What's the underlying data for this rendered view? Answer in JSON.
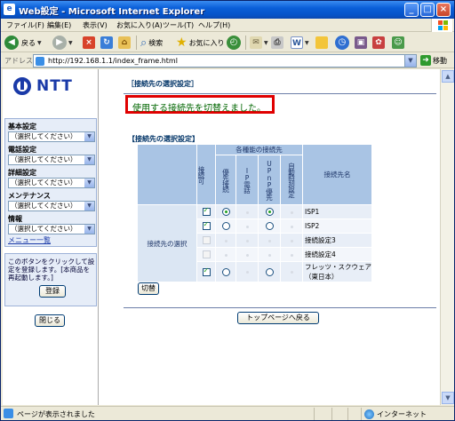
{
  "window": {
    "title": "Web設定 - Microsoft Internet Explorer",
    "min": "_",
    "max": "□",
    "close": "×"
  },
  "menu": [
    "ファイル(F)",
    "編集(E)",
    "表示(V)",
    "お気に入り(A)",
    "ツール(T)",
    "ヘルプ(H)"
  ],
  "toolbar": {
    "back": "戻る",
    "search": "検索",
    "favorites": "お気に入り"
  },
  "address": {
    "label": "アドレス(D)",
    "url": "http://192.168.1.1/index_frame.html",
    "go": "移動"
  },
  "left": {
    "logo": "NTT",
    "nav": [
      {
        "title": "基本設定",
        "value": "（選択してください）"
      },
      {
        "title": "電話設定",
        "value": "（選択してください）"
      },
      {
        "title": "詳細設定",
        "value": "（選択してください）"
      },
      {
        "title": "メンテナンス",
        "value": "（選択してください）"
      },
      {
        "title": "情報",
        "value": "（選択してください）"
      }
    ],
    "menu_list": "メニュー一覧",
    "hint": "このボタンをクリックして設定を登録します。[本商品を再起動します。]",
    "register": "登録",
    "close": "閉じる"
  },
  "main": {
    "header": "［接続先の選択設定］",
    "message": "使用する接続先を切替えました。",
    "section": "【接続先の選択設定】",
    "table": {
      "col_enable": "接続可",
      "col_group": "各種能の接続先",
      "col_priority": "優先接続",
      "col_ip_phone": "IP電話",
      "col_upnp": "UPnP優先",
      "col_auto": "自動時刻設定",
      "col_name": "接続先名",
      "row_label": "接続先の選択",
      "rows": [
        {
          "enabled": true,
          "name": "ISP1"
        },
        {
          "enabled": true,
          "name": "ISP2"
        },
        {
          "enabled": false,
          "name": "接続設定3"
        },
        {
          "enabled": false,
          "name": "接続設定4"
        },
        {
          "enabled": true,
          "name": "フレッツ・スクウェア（東日本）"
        }
      ]
    },
    "switch": "切替",
    "top_page": "トップページへ戻る"
  },
  "status": {
    "text": "ページが表示されました",
    "zone": "インターネット"
  }
}
